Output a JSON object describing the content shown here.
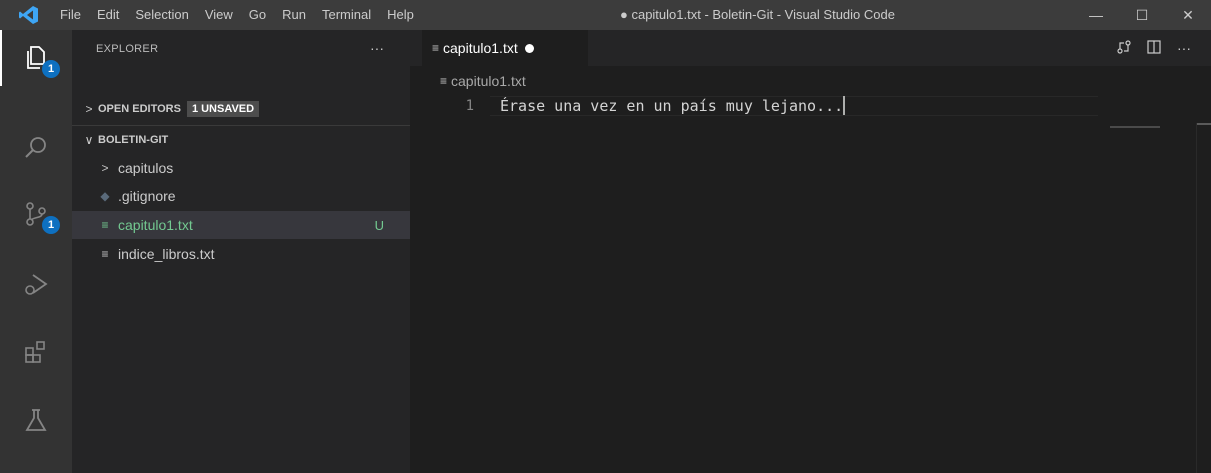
{
  "titlebar": {
    "menu": [
      "File",
      "Edit",
      "Selection",
      "View",
      "Go",
      "Run",
      "Terminal",
      "Help"
    ],
    "window_title": "● capitulo1.txt - Boletin-Git - Visual Studio Code",
    "minimize": "—",
    "maximize": "☐",
    "close": "✕"
  },
  "activitybar": {
    "explorer_badge": "1",
    "scm_badge": "1"
  },
  "sidebar": {
    "header": "EXPLORER",
    "more": "···",
    "open_editors": "OPEN EDITORS",
    "unsaved_badge": "1 UNSAVED",
    "folder": "BOLETIN-GIT",
    "items": [
      {
        "label": "capitulos",
        "type": "folder"
      },
      {
        "label": ".gitignore",
        "type": "file"
      },
      {
        "label": "capitulo1.txt",
        "type": "file",
        "status": "U",
        "selected": true
      },
      {
        "label": "indice_libros.txt",
        "type": "file"
      }
    ]
  },
  "editor": {
    "tab_label": "capitulo1.txt",
    "breadcrumb": "capitulo1.txt",
    "line_number": "1",
    "line_text": "Érase una vez en un país muy lejano...",
    "actions": [
      "compare-changes-icon",
      "split-editor-icon",
      "more-actions-icon"
    ],
    "more_actions": "···"
  },
  "colors": {
    "accent_badge": "#0e70c0",
    "untracked_green": "#73c991",
    "editor_bg": "#1e1e1e",
    "sidebar_bg": "#252526",
    "activitybar_bg": "#333333",
    "titlebar_bg": "#3c3c3c"
  }
}
